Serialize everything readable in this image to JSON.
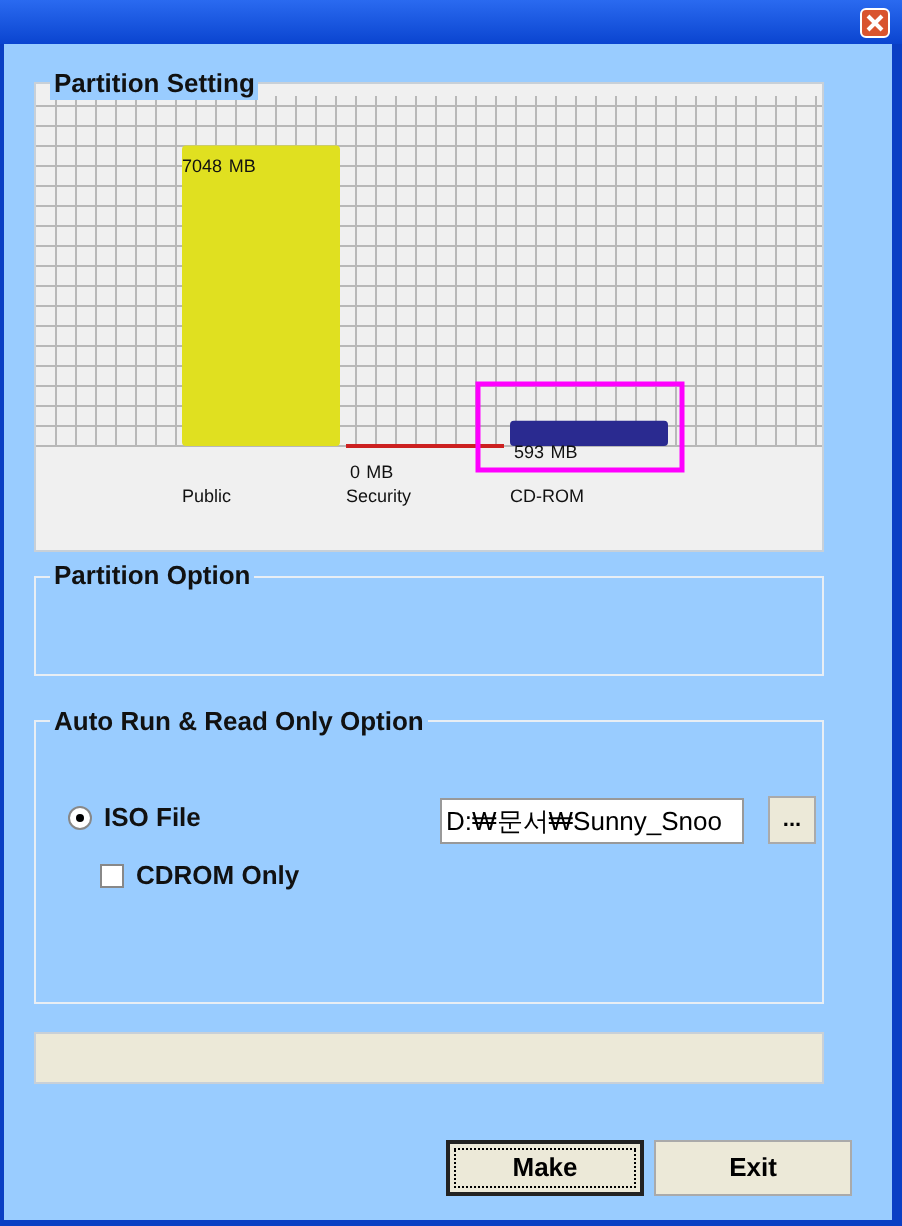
{
  "partition_setting": {
    "title": "Partition Setting",
    "chart_data": {
      "type": "bar",
      "categories": [
        "Public",
        "Security",
        "CD-ROM"
      ],
      "series": [
        {
          "colors": [
            "#e0e020",
            "#cc2020",
            "#2a2a90"
          ],
          "values": [
            7048,
            0,
            593
          ]
        }
      ],
      "data_labels": true
    },
    "value_units": [
      "MB",
      "MB",
      "MB"
    ],
    "highlight_box": true
  },
  "partition_option": {
    "title": "Partition Option"
  },
  "auto_run": {
    "title": "Auto Run & Read Only Option",
    "iso_file": {
      "label": "ISO File",
      "selected": true
    },
    "path_field": {
      "value": "D:₩문서₩Sunny_Snoo"
    },
    "browse_button": {
      "label": "..."
    },
    "cdrom_only": {
      "label": "CDROM Only",
      "checked": false
    }
  },
  "buttons": [
    {
      "label": "Make",
      "focused": true
    },
    {
      "label": "Exit",
      "focused": false
    }
  ]
}
